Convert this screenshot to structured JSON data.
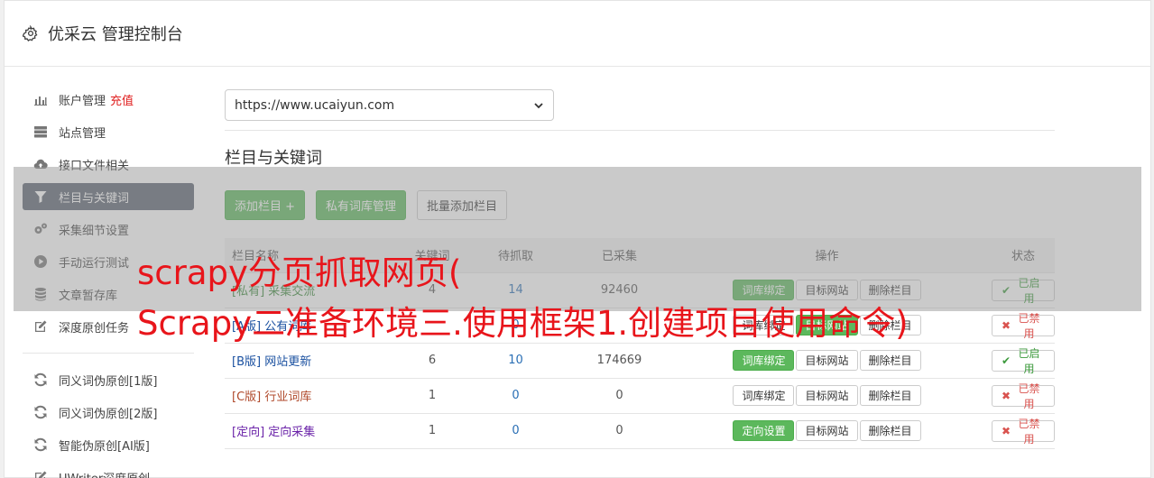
{
  "header": {
    "title": "优采云 管理控制台"
  },
  "sidebar": {
    "group1": [
      {
        "icon": "bar-chart-icon",
        "label": "账户管理",
        "extra": "充值",
        "active": false
      },
      {
        "icon": "server-icon",
        "label": "站点管理",
        "active": false
      },
      {
        "icon": "cloud-upload-icon",
        "label": "接口文件相关",
        "active": false
      },
      {
        "icon": "filter-icon",
        "label": "栏目与关键词",
        "active": true
      },
      {
        "icon": "cogs-icon",
        "label": "采集细节设置",
        "active": false
      },
      {
        "icon": "play-circle-icon",
        "label": "手动运行测试",
        "active": false
      },
      {
        "icon": "database-icon",
        "label": "文章暂存库",
        "active": false
      },
      {
        "icon": "edit-icon",
        "label": "深度原创任务",
        "active": false
      }
    ],
    "group2": [
      {
        "icon": "refresh-icon",
        "label": "同义词伪原创[1版]"
      },
      {
        "icon": "refresh-icon",
        "label": "同义词伪原创[2版]"
      },
      {
        "icon": "refresh-icon",
        "label": "智能伪原创[AI版]"
      },
      {
        "icon": "edit-icon",
        "label": "UWriter深度原创"
      }
    ]
  },
  "main": {
    "site_select": "https://www.ucaiyun.com",
    "section_title": "栏目与关键词",
    "buttons": {
      "add": "添加栏目 +",
      "private_lib": "私有词库管理",
      "batch_add": "批量添加栏目"
    },
    "table": {
      "headers": [
        "栏目名称",
        "关键词",
        "待抓取",
        "已采集",
        "操作",
        "状态"
      ],
      "rows": [
        {
          "prefix": "[私有]",
          "name": "采集交流",
          "color": "#3c8a3c",
          "kw": "4",
          "pending": "14",
          "collected": "92460",
          "op1": "词库绑定",
          "op1_green": true,
          "op2": "目标网站",
          "op2_green": false,
          "op3": "删除栏目",
          "status": "已启用",
          "status_on": true
        },
        {
          "prefix": "[A版]",
          "name": "公有词库",
          "color": "#1a50a0",
          "kw": "",
          "pending": "0",
          "collected": "",
          "op1": "词库绑定",
          "op1_green": false,
          "op2": "目标网站",
          "op2_green": true,
          "op3": "删除栏目",
          "status": "已禁用",
          "status_on": false
        },
        {
          "prefix": "[B版]",
          "name": "网站更新",
          "color": "#1a50a0",
          "kw": "6",
          "pending": "10",
          "collected": "174669",
          "op1": "词库绑定",
          "op1_green": true,
          "op2": "目标网站",
          "op2_green": false,
          "op3": "删除栏目",
          "status": "已启用",
          "status_on": true
        },
        {
          "prefix": "[C版]",
          "name": "行业词库",
          "color": "#b04a2c",
          "kw": "1",
          "pending": "0",
          "collected": "0",
          "op1": "词库绑定",
          "op1_green": false,
          "op2": "目标网站",
          "op2_green": false,
          "op3": "删除栏目",
          "status": "已禁用",
          "status_on": false
        },
        {
          "prefix": "[定向]",
          "name": "定向采集",
          "color": "#6a22a8",
          "kw": "1",
          "pending": "0",
          "collected": "0",
          "op1": "定向设置",
          "op1_green": true,
          "op2": "目标网站",
          "op2_green": false,
          "op3": "删除栏目",
          "status": "已禁用",
          "status_on": false
        }
      ]
    }
  },
  "overlay": {
    "line1": "scrapy分页抓取网页(",
    "line2": "Scrapy二准备环境三.使用框架1.创建项目使用命令)"
  }
}
